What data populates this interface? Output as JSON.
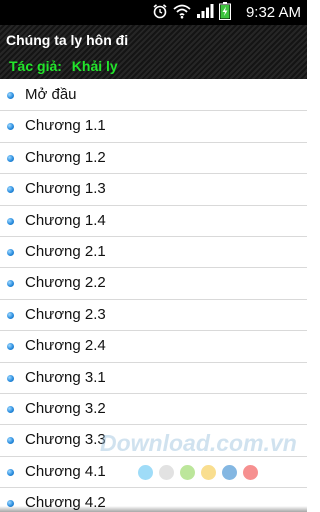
{
  "status_bar": {
    "time": "9:32 AM",
    "icons": [
      "alarm-icon",
      "wifi-icon",
      "signal-icon",
      "battery-charging-icon"
    ],
    "battery_color": "#3ec43e"
  },
  "header": {
    "title": "Chúng ta ly hôn đi",
    "author_label": "Tác giả:",
    "author_name": "Khải ly",
    "author_color": "#22e52b"
  },
  "chapters": [
    {
      "label": "Mở đầu"
    },
    {
      "label": "Chương 1.1"
    },
    {
      "label": "Chương 1.2"
    },
    {
      "label": "Chương 1.3"
    },
    {
      "label": "Chương 1.4"
    },
    {
      "label": "Chương 2.1"
    },
    {
      "label": "Chương 2.2"
    },
    {
      "label": "Chương 2.3"
    },
    {
      "label": "Chương 2.4"
    },
    {
      "label": "Chương 3.1"
    },
    {
      "label": "Chương 3.2"
    },
    {
      "label": "Chương 3.3"
    },
    {
      "label": "Chương 4.1"
    },
    {
      "label": "Chương 4.2"
    }
  ],
  "watermark": {
    "text": "Download.com.vn",
    "dot_colors": [
      "#7fd0f5",
      "#d8d8d8",
      "#a6dd7a",
      "#f7d36a",
      "#5b9fd8",
      "#f36b6b"
    ]
  }
}
